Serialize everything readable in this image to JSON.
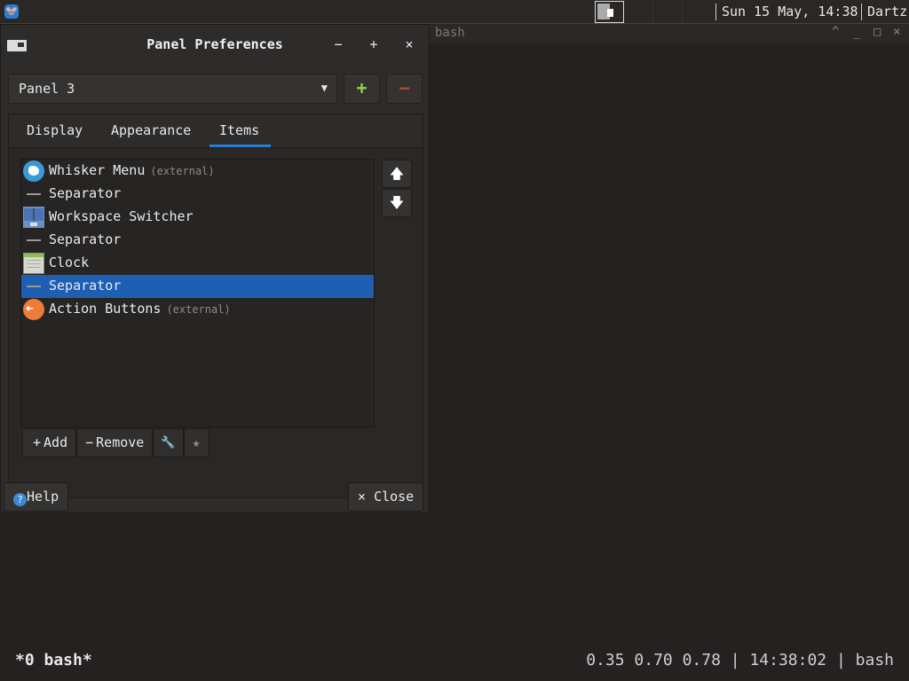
{
  "top_panel": {
    "clock": "Sun 15 May, 14:38",
    "user": "Dartz",
    "whisker_icon": "whisker-menu-icon"
  },
  "terminal": {
    "title": "bash",
    "status_left": "*0 bash*",
    "status_right": "0.35 0.70 0.78 | 14:38:02 | bash",
    "controls": [
      "^",
      "_",
      "□",
      "×"
    ]
  },
  "dialog": {
    "title": "Panel Preferences",
    "window_buttons": {
      "minimize": "−",
      "maximize": "+",
      "close": "×"
    },
    "panel_select": {
      "value": "Panel 3",
      "arrow": "▼"
    },
    "add_panel": "+",
    "remove_panel": "−",
    "tabs": [
      {
        "label": "Display"
      },
      {
        "label": "Appearance"
      },
      {
        "label": "Items",
        "active": true
      }
    ],
    "items": [
      {
        "label": "Whisker Menu",
        "note": "(external)",
        "icon": "whisker-icon"
      },
      {
        "label": "Separator",
        "note": "",
        "icon": "separator-icon"
      },
      {
        "label": "Workspace Switcher",
        "note": "",
        "icon": "workspace-switcher-icon"
      },
      {
        "label": "Separator",
        "note": "",
        "icon": "separator-icon"
      },
      {
        "label": "Clock",
        "note": "",
        "icon": "clock-icon"
      },
      {
        "label": "Separator",
        "note": "",
        "icon": "separator-icon",
        "selected": true
      },
      {
        "label": "Action Buttons",
        "note": "(external)",
        "icon": "action-buttons-icon"
      }
    ],
    "move_up": "🡅",
    "move_down": "🡇",
    "toolbar": {
      "add": "Add",
      "add_glyph": "+",
      "remove": "Remove",
      "remove_glyph": "−",
      "wrench_glyph": "🔧",
      "star_glyph": "★"
    },
    "help": "Help",
    "help_glyph": "?",
    "close": "Close",
    "close_glyph": "×"
  },
  "colors": {
    "accent": "#2a7fd4",
    "selection": "#1f5fb3",
    "add_green": "#8fd44a",
    "remove_red": "#b84a3a"
  }
}
